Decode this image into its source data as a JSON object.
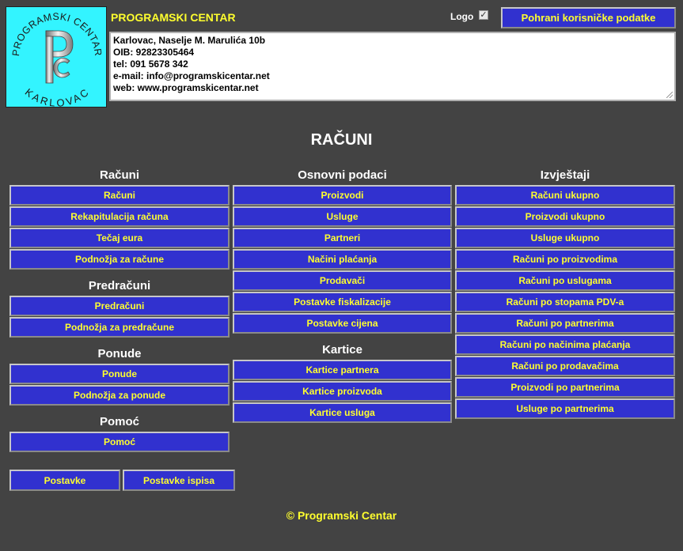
{
  "header": {
    "logo_top_text": "PROGRAMSKI CENTAR",
    "logo_bottom_text": "KARLOVAC",
    "logo_monogram": "PC",
    "company_name": "PROGRAMSKI CENTAR",
    "logo_toggle_label": "Logo",
    "logo_toggle_checked": true,
    "save_button": "Pohrani korisničke podatke",
    "info_lines": [
      "Karlovac, Naselje M. Marulića 10b",
      "OIB: 92823305464",
      "tel: 091 5678 342",
      "e-mail: info@programskicentar.net",
      "web: www.programskicentar.net"
    ]
  },
  "page_title": "RAČUNI",
  "columns": {
    "left": {
      "sections": [
        {
          "title": "Računi",
          "items": [
            "Računi",
            "Rekapitulacija računa",
            "Tečaj eura",
            "Podnožja za račune"
          ]
        },
        {
          "title": "Predračuni",
          "items": [
            "Predračuni",
            "Podnožja za predračune"
          ]
        },
        {
          "title": "Ponude",
          "items": [
            "Ponude",
            "Podnožja za ponude"
          ]
        },
        {
          "title": "Pomoć",
          "items": [
            "Pomoć"
          ]
        }
      ]
    },
    "middle": {
      "sections": [
        {
          "title": "Osnovni podaci",
          "items": [
            "Proizvodi",
            "Usluge",
            "Partneri",
            "Načini plaćanja",
            "Prodavači",
            "Postavke fiskalizacije",
            "Postavke cijena"
          ]
        },
        {
          "title": "Kartice",
          "items": [
            "Kartice partnera",
            "Kartice proizvoda",
            "Kartice usluga"
          ]
        }
      ]
    },
    "right": {
      "sections": [
        {
          "title": "Izvještaji",
          "items": [
            "Računi ukupno",
            "Proizvodi ukupno",
            "Usluge ukupno",
            "Računi po proizvodima",
            "Računi po uslugama",
            "Računi po stopama PDV-a",
            "Računi po partnerima",
            "Računi po načinima plaćanja",
            "Računi po prodavačima",
            "Proizvodi po partnerima",
            "Usluge po partnerima"
          ]
        }
      ]
    }
  },
  "bottom_buttons": {
    "settings": "Postavke",
    "print_settings": "Postavke ispisa"
  },
  "footer": "© Programski Centar",
  "colors": {
    "background": "#434343",
    "button": "#3131cf",
    "button_text": "#ffff2e",
    "logo_bg": "#33f4ff"
  }
}
